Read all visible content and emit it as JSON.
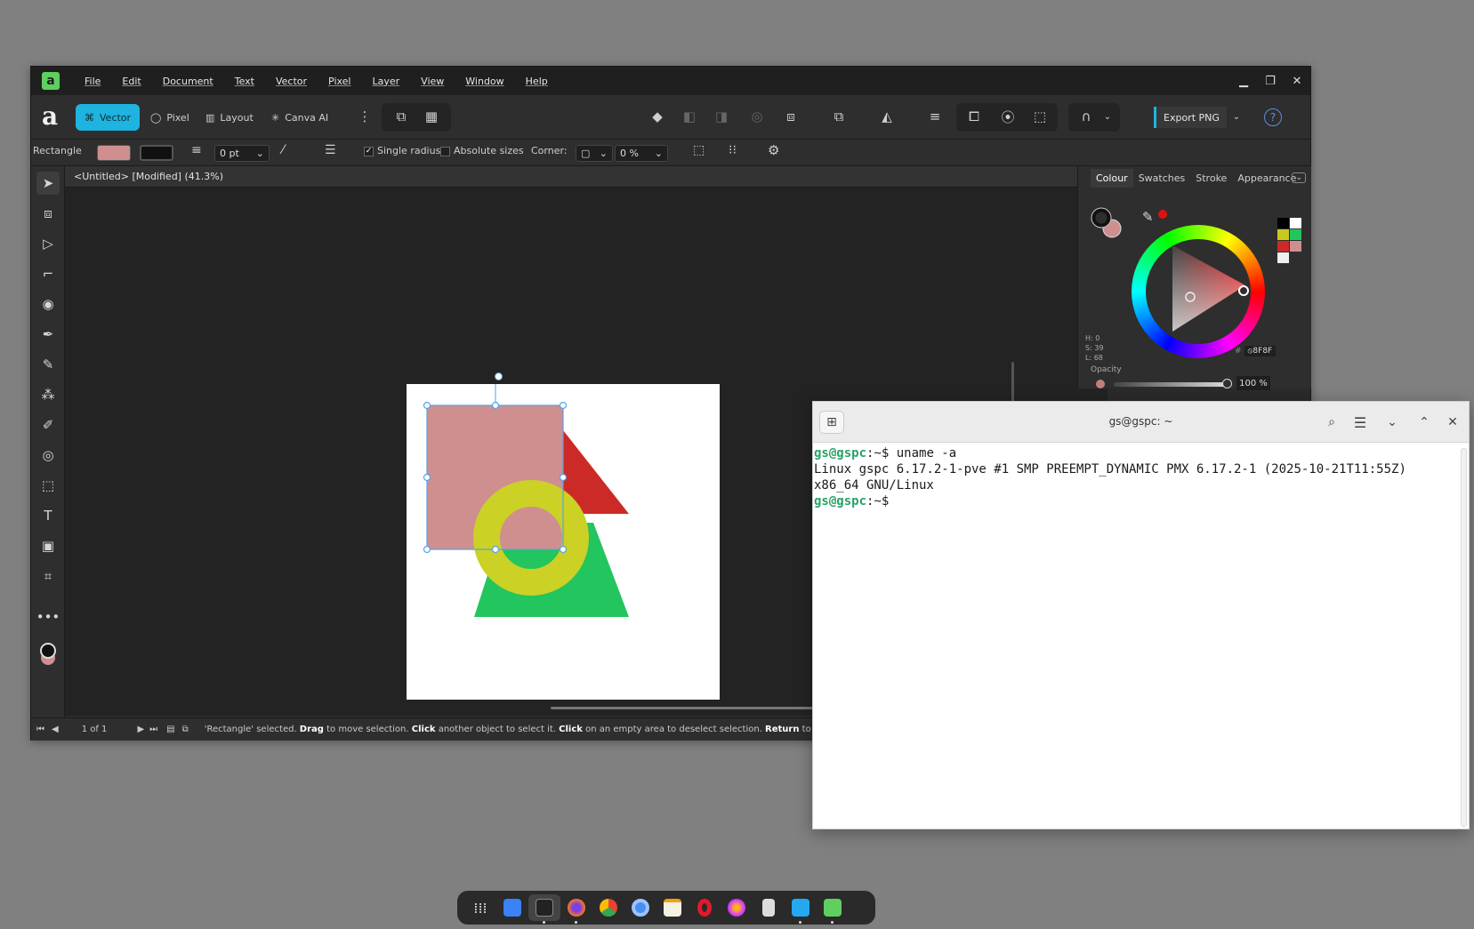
{
  "affinity": {
    "menu": [
      "File",
      "Edit",
      "Document",
      "Text",
      "Vector",
      "Pixel",
      "Layer",
      "View",
      "Window",
      "Help"
    ],
    "personas": {
      "vector": "Vector",
      "pixel": "Pixel",
      "layout": "Layout",
      "canva_ai": "Canva AI"
    },
    "export_label": "Export PNG",
    "context": {
      "tool_name": "Rectangle",
      "fill_color": "#cf8f8f",
      "stroke_width": "0 pt",
      "single_radius_label": "Single radius",
      "absolute_sizes_label": "Absolute sizes",
      "corner_label": "Corner:",
      "corner_value": "0 %"
    },
    "document_tab": "<Untitled> [Modified] (41.3%)",
    "panel": {
      "tabs": [
        "Colour",
        "Swatches",
        "Stroke",
        "Appearance"
      ],
      "hsl_h": "H: 0",
      "hsl_s": "S: 39",
      "hsl_l": "L: 68",
      "hex": "8F8F",
      "opacity_label": "Opacity",
      "opacity_value": "100 %"
    },
    "status": {
      "page_info": "1 of 1",
      "msg_1": "'Rectangle' selected. ",
      "msg_drag": "Drag",
      "msg_2": " to move selection. ",
      "msg_click": "Click",
      "msg_3": " another object to select it. ",
      "msg_click2": "Click",
      "msg_4": " on an empty area to deselect selection. ",
      "msg_return": "Return",
      "msg_5": " to e"
    }
  },
  "terminal": {
    "title": "gs@gspc: ~",
    "prompt_user": "gs@gspc",
    "prompt_path": ":~$ ",
    "command": "uname -a",
    "output_1": "Linux gspc 6.17.2-1-pve #1 SMP PREEMPT_DYNAMIC PMX 6.17.2-1 (2025-10-21T11:55Z)",
    "output_2": "x86_64 GNU/Linux"
  },
  "dock_items": [
    "app-grid-icon",
    "files-icon",
    "terminal-icon",
    "firefox-icon",
    "chrome-icon",
    "chromium-icon",
    "text-editor-icon",
    "opera-icon",
    "browser-icon",
    "calculator-icon",
    "vscode-icon",
    "affinity-icon"
  ]
}
